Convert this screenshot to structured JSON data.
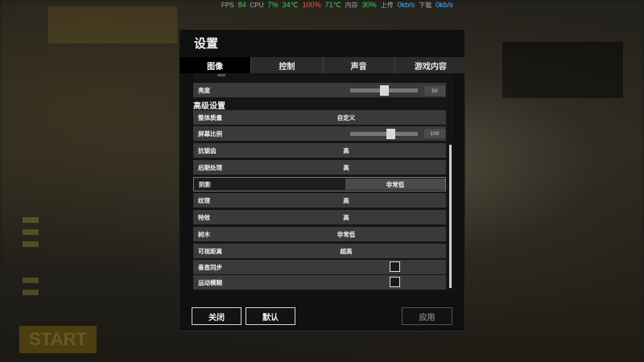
{
  "sysbar": {
    "fps_label": "FPS",
    "fps_value": "84",
    "cpu_label": "CPU",
    "cpu_usage": "7%",
    "cpu_temp": "34℃",
    "gpu_usage": "100%",
    "gpu_temp": "71℃",
    "mem_label": "内存",
    "mem_value": "30%",
    "up_label": "上传",
    "up_value": "0kb/s",
    "down_label": "下载",
    "down_value": "0kb/s"
  },
  "background": {
    "start_label": "START"
  },
  "dialog": {
    "title": "设置",
    "tabs": [
      {
        "label": "图像",
        "active": true
      },
      {
        "label": "控制",
        "active": false
      },
      {
        "label": "声音",
        "active": false
      },
      {
        "label": "游戏内容",
        "active": false
      }
    ],
    "brightness": {
      "label": "亮度",
      "value": "50",
      "fraction": 0.5
    },
    "section_title": "高级设置",
    "overall_quality": {
      "label": "整体质量",
      "value": "自定义"
    },
    "screen_scale": {
      "label": "屏幕比例",
      "value": "100",
      "fraction": 0.6
    },
    "settings": [
      {
        "label": "抗锯齿",
        "value": "高"
      },
      {
        "label": "后期处理",
        "value": "高"
      },
      {
        "label": "阴影",
        "value": "非常低",
        "selected": true
      },
      {
        "label": "纹理",
        "value": "高"
      },
      {
        "label": "特效",
        "value": "高"
      },
      {
        "label": "树木",
        "value": "非常低"
      },
      {
        "label": "可视距离",
        "value": "超高"
      }
    ],
    "vsync": {
      "label": "垂直同步",
      "checked": false
    },
    "motion_blur": {
      "label": "运动模糊",
      "checked": false
    },
    "buttons": {
      "close": "关闭",
      "default": "默认",
      "apply": "应用"
    }
  }
}
